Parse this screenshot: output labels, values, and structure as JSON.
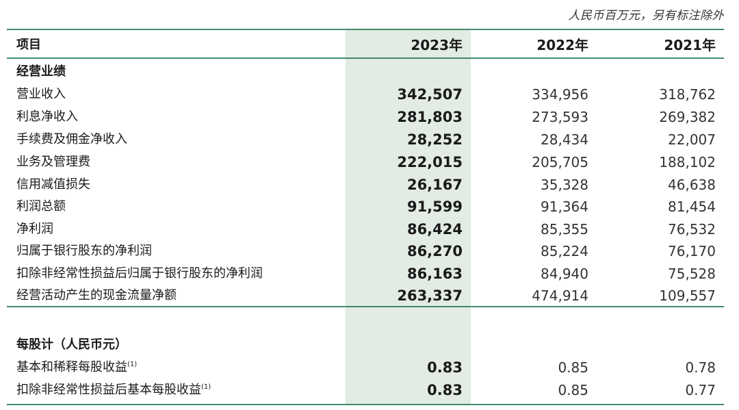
{
  "unit_note": "人民币百万元，另有标注除外",
  "header": {
    "label": "项目",
    "y2023": "2023年",
    "y2022": "2022年",
    "y2021": "2021年"
  },
  "section1": {
    "title": "经营业绩"
  },
  "rows": [
    {
      "label": "营业收入",
      "v2023": "342,507",
      "v2022": "334,956",
      "v2021": "318,762"
    },
    {
      "label": "利息净收入",
      "v2023": "281,803",
      "v2022": "273,593",
      "v2021": "269,382"
    },
    {
      "label": "手续费及佣金净收入",
      "v2023": "28,252",
      "v2022": "28,434",
      "v2021": "22,007"
    },
    {
      "label": "业务及管理费",
      "v2023": "222,015",
      "v2022": "205,705",
      "v2021": "188,102"
    },
    {
      "label": "信用减值损失",
      "v2023": "26,167",
      "v2022": "35,328",
      "v2021": "46,638"
    },
    {
      "label": "利润总额",
      "v2023": "91,599",
      "v2022": "91,364",
      "v2021": "81,454"
    },
    {
      "label": "净利润",
      "v2023": "86,424",
      "v2022": "85,355",
      "v2021": "76,532"
    },
    {
      "label": "归属于银行股东的净利润",
      "v2023": "86,270",
      "v2022": "85,224",
      "v2021": "76,170"
    },
    {
      "label": "扣除非经常性损益后归属于银行股东的净利润",
      "v2023": "86,163",
      "v2022": "84,940",
      "v2021": "75,528"
    },
    {
      "label": "经营活动产生的现金流量净额",
      "v2023": "263,337",
      "v2022": "474,914",
      "v2021": "109,557"
    }
  ],
  "section2": {
    "title": "每股计（人民币元）"
  },
  "eps_rows": [
    {
      "label": "基本和稀释每股收益",
      "note": "(1)",
      "v2023": "0.83",
      "v2022": "0.85",
      "v2021": "0.78"
    },
    {
      "label": "扣除非经常性损益后基本每股收益",
      "note": "(1)",
      "v2023": "0.83",
      "v2022": "0.85",
      "v2021": "0.77"
    }
  ]
}
